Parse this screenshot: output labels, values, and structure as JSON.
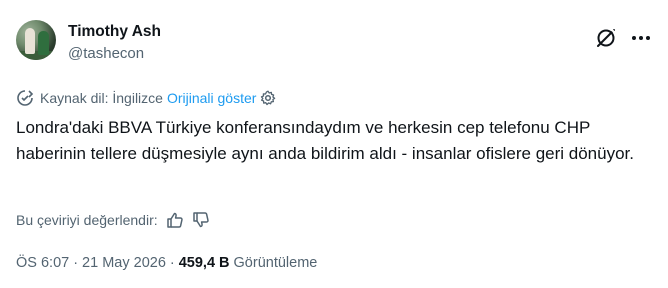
{
  "author": {
    "name": "Timothy Ash",
    "handle": "@tashecon"
  },
  "translation": {
    "source_label": "Kaynak dil: İngilizce",
    "show_original": "Orijinali göster"
  },
  "tweet": {
    "text": "Londra'daki BBVA Türkiye konferansındaydım ve herkesin cep telefonu CHP haberinin tellere düşmesiyle aynı anda bildirim aldı - insanlar ofislere geri dönüyor."
  },
  "rating": {
    "prompt": "Bu çeviriyi değerlendir:"
  },
  "meta": {
    "time": "ÖS 6:07",
    "separator": "·",
    "date": "21 May 2026",
    "views_count": "459,4 B",
    "views_label": "Görüntüleme"
  },
  "colors": {
    "text": "#0f1419",
    "secondary": "#536471",
    "link": "#1d9bf0"
  },
  "icons": [
    "grok-icon",
    "more-icon",
    "translate-icon",
    "gear-icon",
    "thumbs-up-icon",
    "thumbs-down-icon"
  ]
}
